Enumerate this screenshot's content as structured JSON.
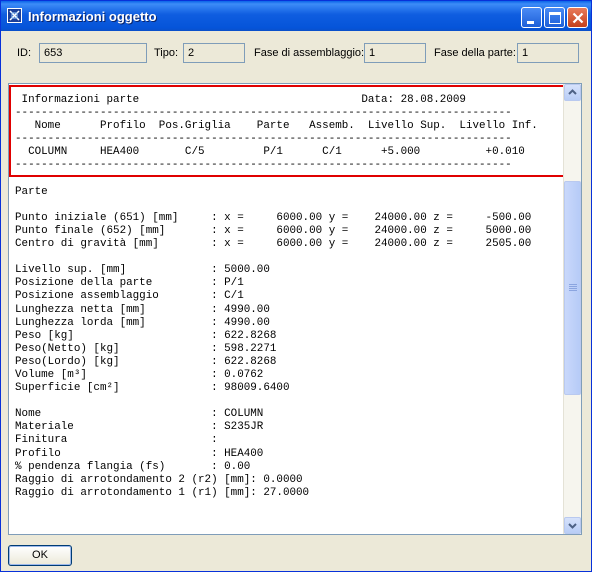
{
  "window": {
    "title": "Informazioni oggetto",
    "titlebar_color": "#0a5ae0",
    "highlight_color": "#e00000"
  },
  "fields": [
    {
      "label": "ID:",
      "value": "653"
    },
    {
      "label": "Tipo:",
      "value": "2"
    },
    {
      "label": "Fase di assemblaggio:",
      "value": "1"
    },
    {
      "label": "Fase della parte:",
      "value": "1"
    }
  ],
  "report_text": " Informazioni parte                                  Data: 28.08.2009\n----------------------------------------------------------------------------\n   Nome      Profilo  Pos.Griglia    Parte   Assemb.  Livello Sup.  Livello Inf.\n----------------------------------------------------------------------------\n  COLUMN     HEA400       C/5         P/1      C/1      +5.000          +0.010\n----------------------------------------------------------------------------\n\nParte\n\nPunto iniziale (651) [mm]     : x =     6000.00 y =    24000.00 z =     -500.00\nPunto finale (652) [mm]       : x =     6000.00 y =    24000.00 z =     5000.00\nCentro di gravità [mm]        : x =     6000.00 y =    24000.00 z =     2505.00\n\nLivello sup. [mm]             : 5000.00\nPosizione della parte         : P/1\nPosizione assemblaggio        : C/1\nLunghezza netta [mm]          : 4990.00\nLunghezza lorda [mm]          : 4990.00\nPeso [kg]                     : 622.8268\nPeso(Netto) [kg]              : 598.2271\nPeso(Lordo) [kg]              : 622.8268\nVolume [m³]                   : 0.0762\nSuperficie [cm²]              : 98009.6400\n\nNome                          : COLUMN\nMateriale                     : S235JR\nFinitura                      :\nProfilo                       : HEA400\n% pendenza flangia (fs)       : 0.00\nRaggio di arrotondamento 2 (r2) [mm]: 0.0000\nRaggio di arrotondamento 1 (r1) [mm]: 27.0000",
  "buttons": {
    "ok": "OK"
  },
  "icons": {
    "app": "app-icon",
    "minimize": "minimize-icon",
    "maximize": "maximize-icon",
    "close": "close-icon",
    "scroll_up": "chevron-up-icon",
    "scroll_down": "chevron-down-icon"
  }
}
